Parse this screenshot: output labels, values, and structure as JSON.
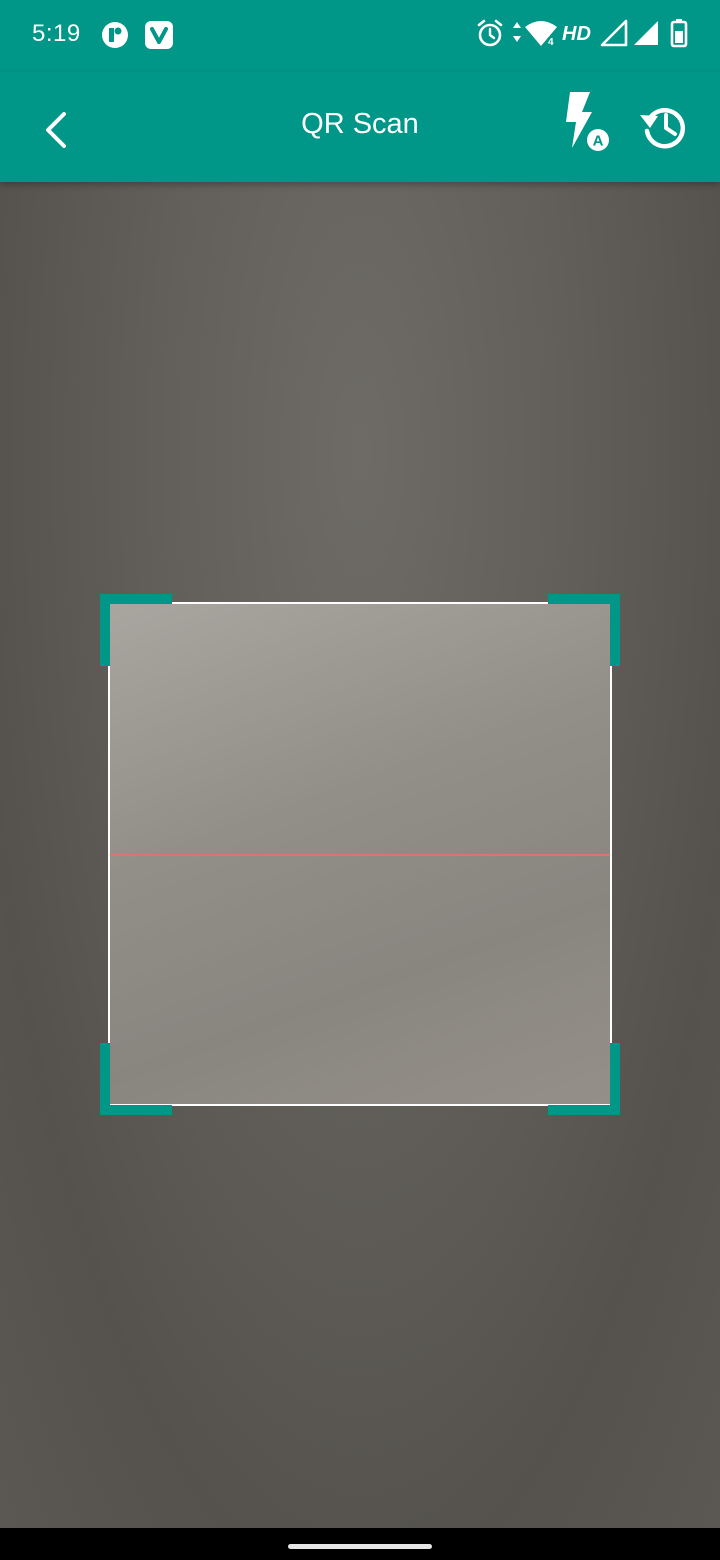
{
  "status_bar": {
    "time": "5:19",
    "network_label": "HD",
    "notification_icons": [
      "app-notification-icon",
      "vivaldi-icon"
    ],
    "system_icons": [
      "alarm-icon",
      "data-arrows-icon",
      "wifi-icon",
      "signal-icon",
      "signal-icon",
      "battery-icon"
    ]
  },
  "app_bar": {
    "title": "QR Scan",
    "back_icon": "back-arrow-icon",
    "flash_icon": "flash-auto-icon",
    "flash_badge": "A",
    "history_icon": "history-icon"
  },
  "scanner": {
    "frame_color": "#ffffff",
    "corner_color": "#009688",
    "scan_line_color": "#d4796b"
  },
  "colors": {
    "primary": "#009688",
    "on_primary": "#ffffff"
  }
}
